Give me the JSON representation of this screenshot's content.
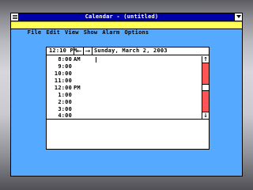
{
  "window": {
    "title": "Calendar - (untitled)"
  },
  "menu": {
    "items": [
      "File",
      "Edit",
      "View",
      "Show",
      "Alarm",
      "Options"
    ]
  },
  "calendar": {
    "current_time": "12:10 PM",
    "prev_arrow": "←",
    "next_arrow": "→",
    "date": "Sunday, March 2, 2003",
    "slots": [
      {
        "time": "8:00",
        "label": "AM"
      },
      {
        "time": "9:00",
        "label": ""
      },
      {
        "time": "10:00",
        "label": ""
      },
      {
        "time": "11:00",
        "label": ""
      },
      {
        "time": "12:00",
        "label": "PM"
      },
      {
        "time": "1:00",
        "label": ""
      },
      {
        "time": "2:00",
        "label": ""
      },
      {
        "time": "3:00",
        "label": ""
      },
      {
        "time": "4:00",
        "label": ""
      }
    ],
    "scroll_up": "↑",
    "scroll_down": "↓",
    "notes_text": ""
  },
  "colors": {
    "titlebar": "#0000aa",
    "menubar": "#ffff55",
    "window_bg": "#55aaff",
    "scrollbar": "#ff5555"
  }
}
